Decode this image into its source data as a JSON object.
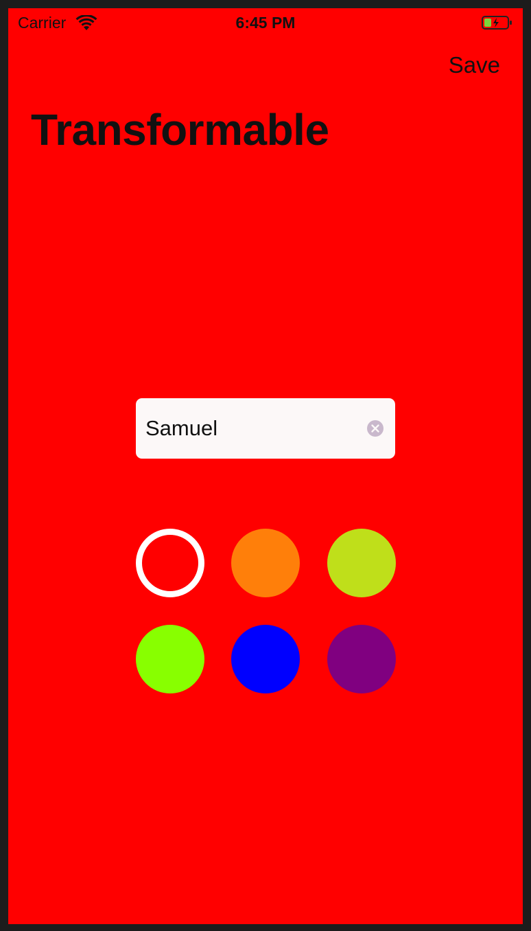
{
  "status_bar": {
    "carrier": "Carrier",
    "time": "6:45 PM",
    "wifi_icon": "wifi-icon",
    "battery_icon": "battery-charging-icon"
  },
  "nav": {
    "save_label": "Save"
  },
  "title": "Transformable",
  "name_field": {
    "value": "Samuel",
    "clear_icon": "clear-circle-icon"
  },
  "colors": {
    "background": "#ff0000",
    "swatches": [
      {
        "name": "red",
        "hex": "#ff0000",
        "selected": true
      },
      {
        "name": "orange",
        "hex": "#ff7f0a"
      },
      {
        "name": "yellow-green",
        "hex": "#bfdf1a"
      },
      {
        "name": "green",
        "hex": "#88ff00"
      },
      {
        "name": "blue",
        "hex": "#0000ff"
      },
      {
        "name": "purple",
        "hex": "#800080"
      }
    ]
  }
}
